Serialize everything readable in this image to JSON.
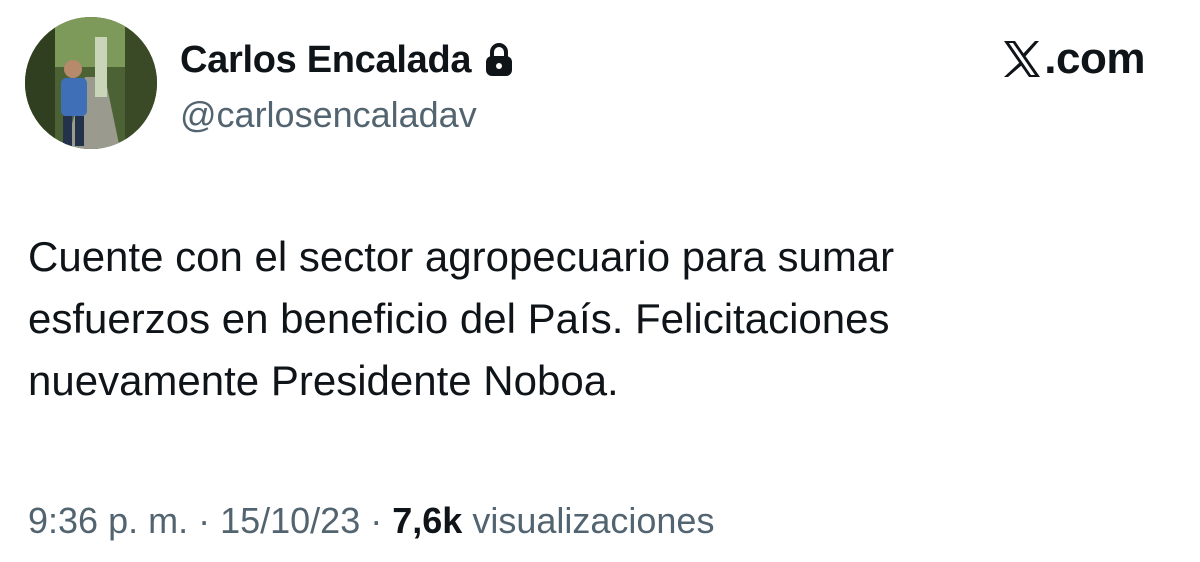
{
  "author": {
    "name": "Carlos Encalada",
    "handle": "@carlosencaladav",
    "protected_icon": "lock-icon",
    "avatar": "profile-photo"
  },
  "brand": {
    "logo_icon": "x-logo-icon",
    "text": ".com"
  },
  "tweet": {
    "lines": [
      "Cuente con el sector agropecuario para sumar",
      "esfuerzos en beneficio del País. Felicitaciones",
      "nuevamente Presidente Noboa."
    ]
  },
  "meta": {
    "time": "9:36 p. m.",
    "separator": " · ",
    "date": "15/10/23",
    "views_count": "7,6k",
    "views_label": "visualizaciones"
  },
  "colors": {
    "primary_text": "#0f1419",
    "secondary_text": "#536471",
    "background": "#ffffff"
  }
}
